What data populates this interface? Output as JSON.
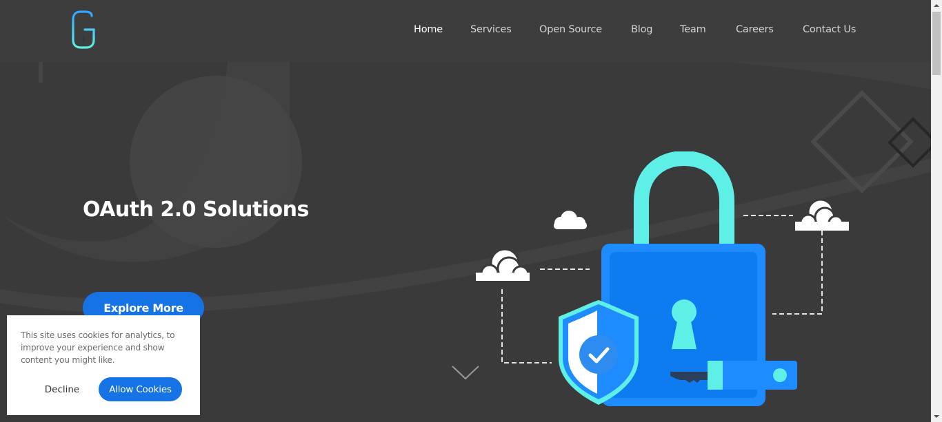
{
  "nav": {
    "items": [
      {
        "label": "Home",
        "active": true
      },
      {
        "label": "Services",
        "active": false
      },
      {
        "label": "Open Source",
        "active": false
      },
      {
        "label": "Blog",
        "active": false
      },
      {
        "label": "Team",
        "active": false
      },
      {
        "label": "Careers",
        "active": false
      },
      {
        "label": "Contact Us",
        "active": false
      }
    ]
  },
  "logo": {
    "icon": "gluu-g-logo",
    "gradient": [
      "#5ef0e6",
      "#1e8bff"
    ]
  },
  "hero": {
    "title": "OAuth 2.0 Solutions",
    "cta_label": "Explore More",
    "scroll_icon": "chevron-down-icon"
  },
  "cookie_banner": {
    "text": "This site uses cookies for analytics, to improve your experience and show content you might like.",
    "decline_label": "Decline",
    "allow_label": "Allow Cookies"
  },
  "colors": {
    "background": "#3a3a3a",
    "accent": "#1673e6",
    "lock_body": "#1e8bff",
    "lock_shackle": "#5ef0e6"
  }
}
